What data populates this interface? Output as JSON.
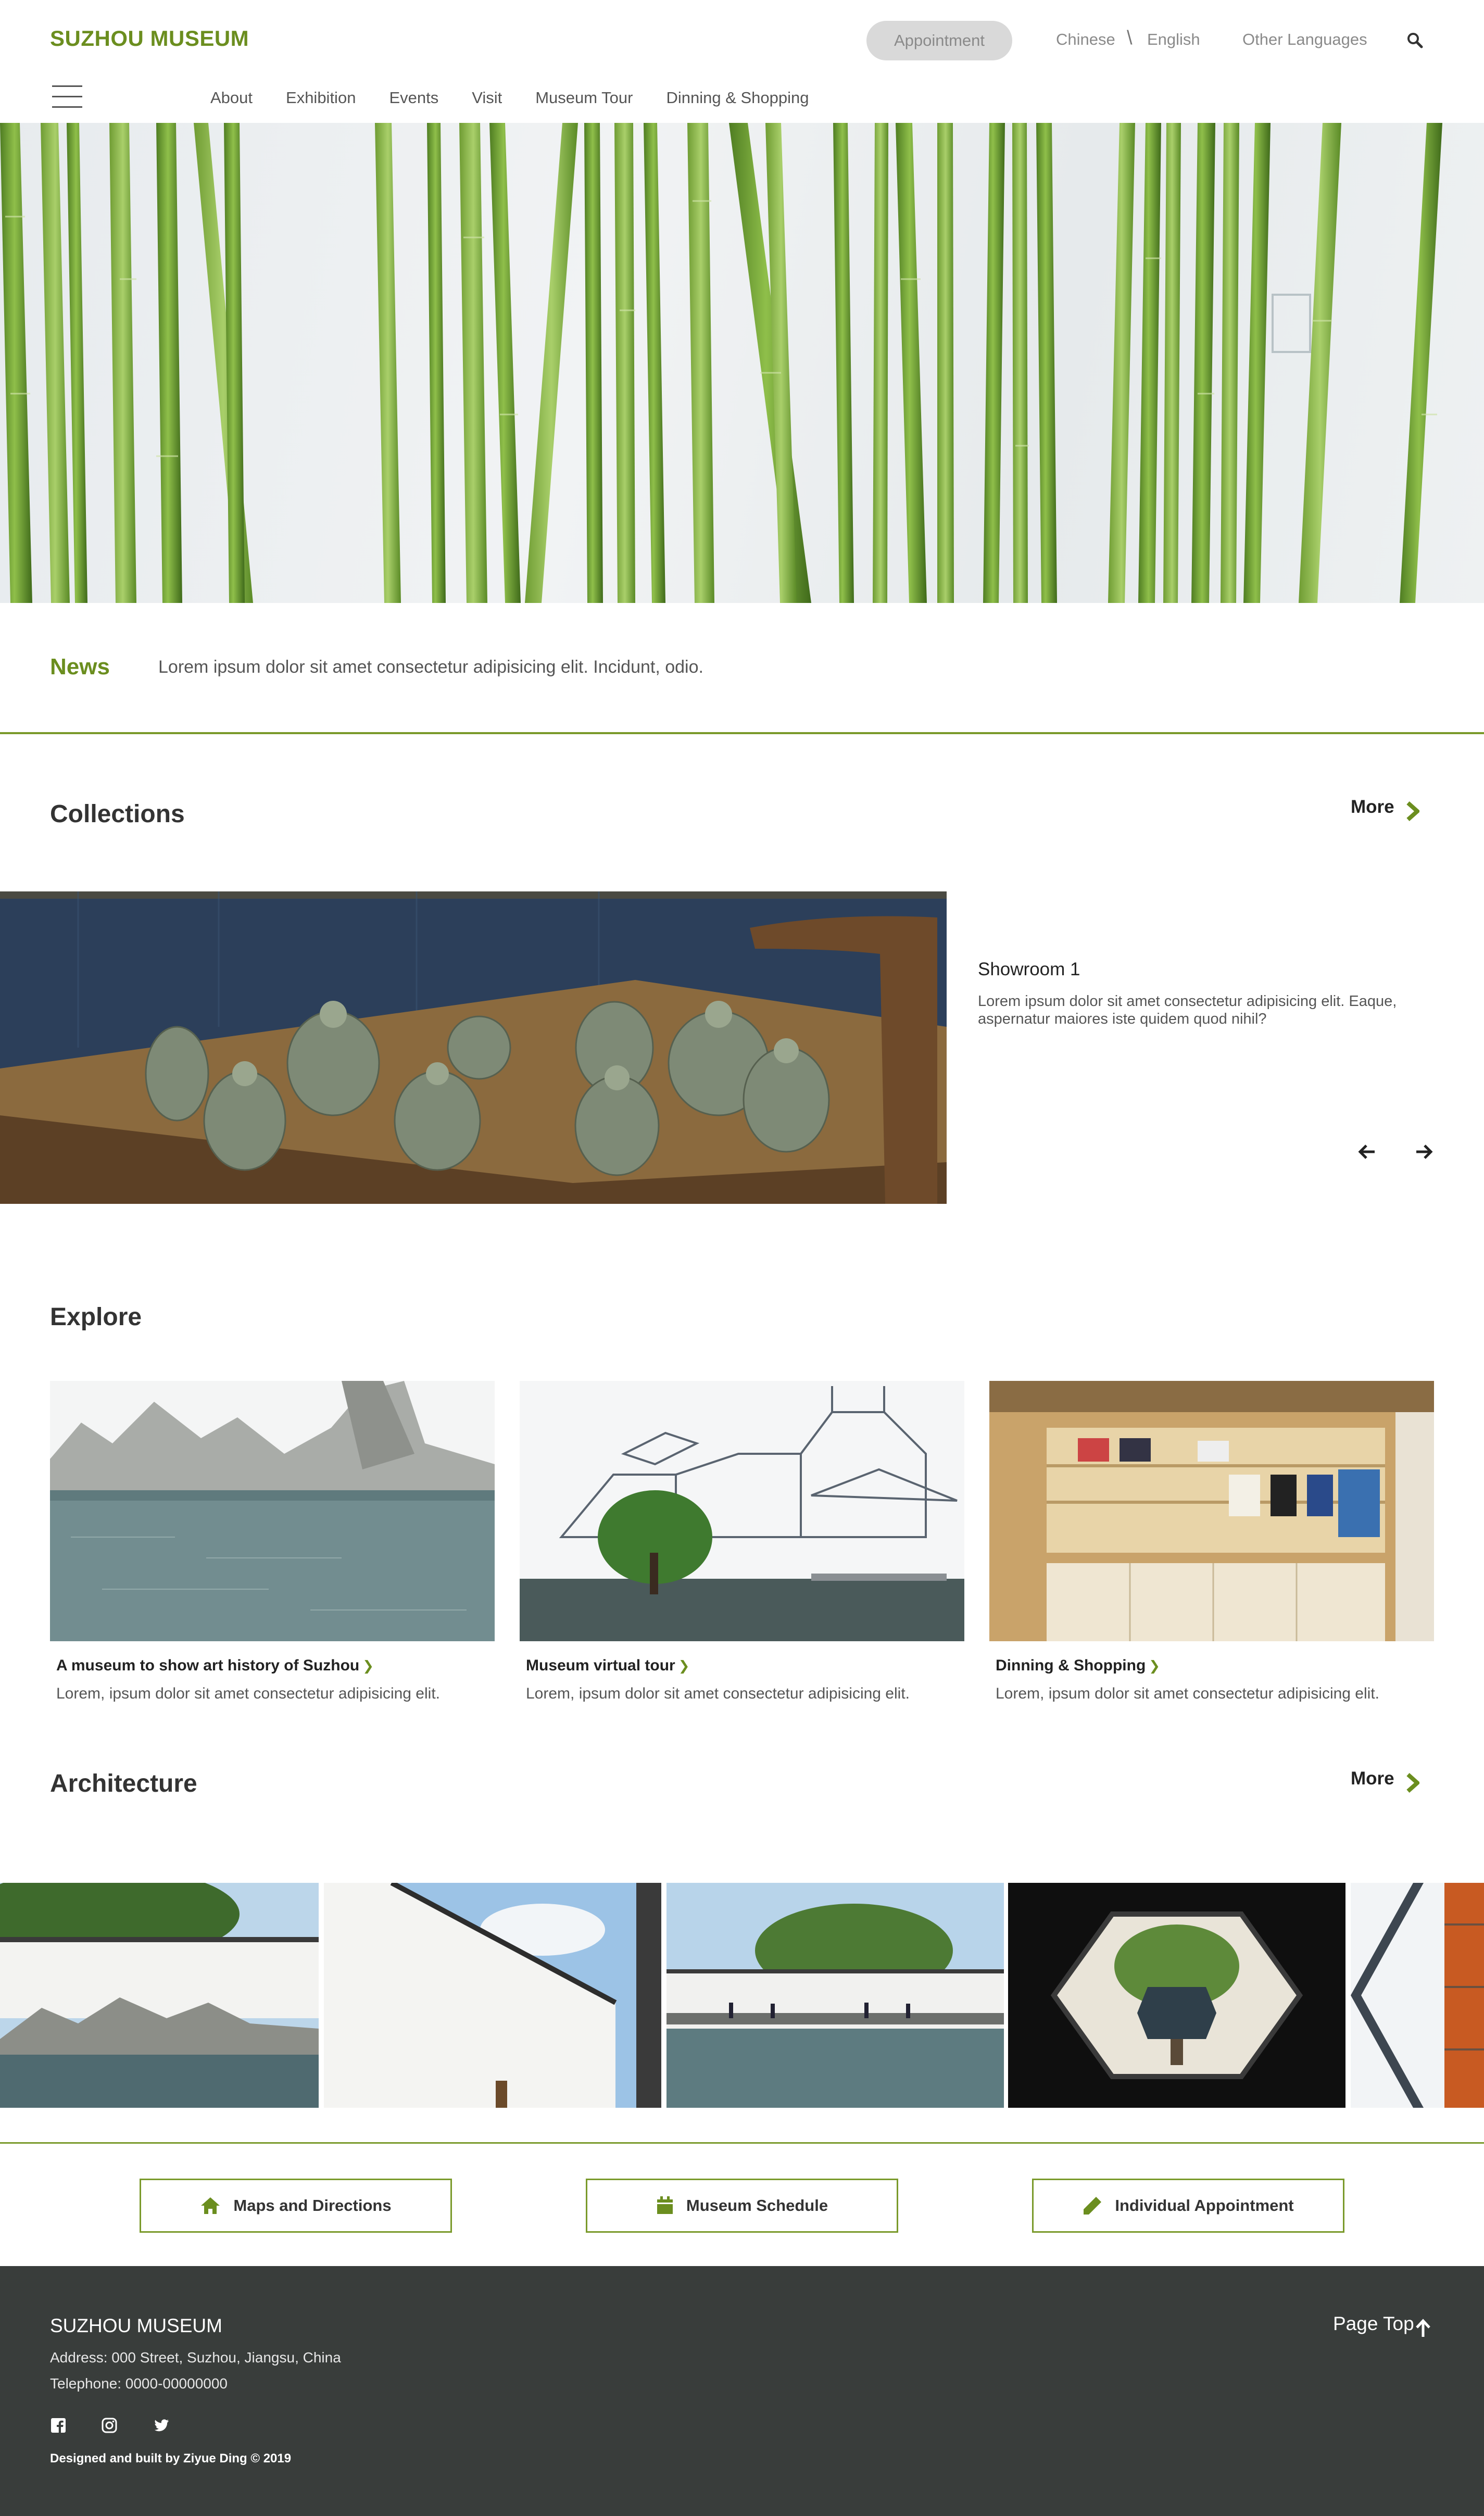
{
  "header": {
    "logo": "SUZHOU MUSEUM",
    "appointment": "Appointment",
    "lang_chinese": "Chinese",
    "lang_sep": "\\",
    "lang_english": "English",
    "other_languages": "Other Languages",
    "search_icon": "search-icon",
    "menu_icon": "hamburger-menu-icon"
  },
  "nav": {
    "items": [
      "About",
      "Exhibition",
      "Events",
      "Visit",
      "Museum Tour",
      "Dinning & Shopping"
    ]
  },
  "news": {
    "title": "News",
    "text": "Lorem ipsum dolor sit amet consectetur adipisicing elit. Incidunt, odio."
  },
  "collections": {
    "title": "Collections",
    "more": "More",
    "showroom_title": "Showroom 1",
    "showroom_desc": "Lorem ipsum dolor sit amet consectetur adipisicing elit. Eaque, aspernatur maiores iste quidem quod nihil?"
  },
  "explore": {
    "title": "Explore",
    "cards": [
      {
        "title": "A museum to show art history of Suzhou",
        "desc": "Lorem, ipsum dolor sit amet consectetur adipisicing elit."
      },
      {
        "title": "Museum virtual tour",
        "desc": "Lorem, ipsum dolor sit amet consectetur adipisicing elit."
      },
      {
        "title": "Dinning & Shopping",
        "desc": "Lorem, ipsum dolor sit amet consectetur adipisicing elit."
      }
    ]
  },
  "architecture": {
    "title": "Architecture",
    "more": "More"
  },
  "actions": {
    "maps": "Maps and Directions",
    "schedule": "Museum Schedule",
    "appointment": "Individual Appointment"
  },
  "footer": {
    "name": "SUZHOU MUSEUM",
    "address": "Address: 000 Street, Suzhou, Jiangsu, China",
    "telephone": "Telephone: 0000-00000000",
    "credit": "Designed and built by Ziyue Ding © 2019",
    "page_top": "Page Top",
    "social_icons": [
      "facebook-icon",
      "instagram-icon",
      "twitter-icon"
    ]
  },
  "colors": {
    "accent": "#6b8e1f",
    "footer_bg": "#393d3b",
    "appointment_bg": "#d9d9d9"
  }
}
